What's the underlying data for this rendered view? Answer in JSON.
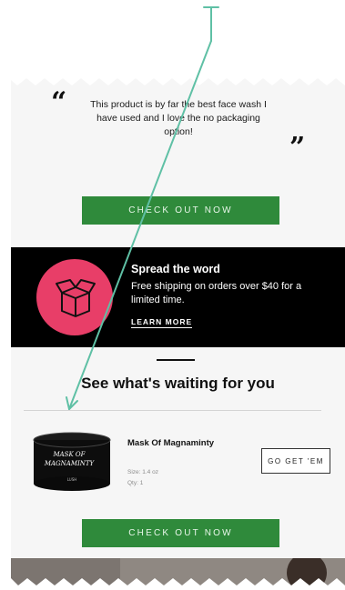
{
  "review": {
    "quote_open": "“",
    "quote_close": "”",
    "text": "This product is by far the best face wash I have used and I love the no packaging option!"
  },
  "cta_primary": {
    "label": "CHECK OUT NOW"
  },
  "promo": {
    "title": "Spread the word",
    "body": "Free shipping on orders over $40 for a limited time.",
    "link": "LEARN MORE",
    "icon": "open-box-icon",
    "accent_color": "#e83e68"
  },
  "cart": {
    "heading": "See what's waiting for you",
    "item": {
      "name": "Mask Of Magnaminty",
      "size": "Size: 1.4 oz",
      "qty": "Qty: 1",
      "image_label": "MASK OF MAGNAMINTY",
      "brand": "LUSH"
    },
    "item_button": "GO GET 'EM"
  },
  "cta_secondary": {
    "label": "CHECK OUT NOW"
  },
  "colors": {
    "cta_green": "#2f8a3b",
    "annotation_arrow": "#5fc0a5",
    "promo_bg": "#000000"
  }
}
